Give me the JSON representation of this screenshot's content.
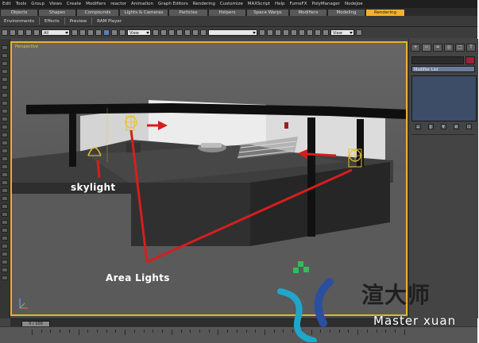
{
  "menu": [
    "Edit",
    "Tools",
    "Group",
    "Views",
    "Create",
    "Modifiers",
    "reactor",
    "Animation",
    "Graph Editors",
    "Rendering",
    "Customize",
    "MAXScript",
    "Help",
    "FumeFX",
    "PolyManager",
    "NodeJoe"
  ],
  "command_tabs": [
    {
      "label": "Objects",
      "active": false
    },
    {
      "label": "Shapes",
      "active": false
    },
    {
      "label": "Compounds",
      "active": false
    },
    {
      "label": "Lights & Cameras",
      "active": false
    },
    {
      "label": "Particles",
      "active": false
    },
    {
      "label": "Helpers",
      "active": false
    },
    {
      "label": "Space Warps",
      "active": false
    },
    {
      "label": "Modifiers",
      "active": false
    },
    {
      "label": "Modeling",
      "active": false
    },
    {
      "label": "Rendering",
      "active": true
    }
  ],
  "ribbon": [
    "Environments",
    "Effects",
    "Preview",
    "RAM Player"
  ],
  "toolbar": {
    "selection_filter": "All",
    "ref_coord": "View",
    "named_sel": "",
    "ref_coord_2": "View"
  },
  "viewport": {
    "label": "Perspective",
    "annotations": {
      "skylight": "skylight",
      "area_lights": "Area Lights"
    },
    "accent_color": "#e8b230",
    "arrow_color": "#d61e1e"
  },
  "command_panel": {
    "modifier_list": "Modifier List",
    "stack_buttons": [
      "⟂",
      "||",
      "∀",
      "⊘",
      "☐"
    ]
  },
  "timeline": {
    "frame": "0 / 100"
  },
  "watermark": {
    "title": "渲大师",
    "subtitle": "Master xuan"
  }
}
